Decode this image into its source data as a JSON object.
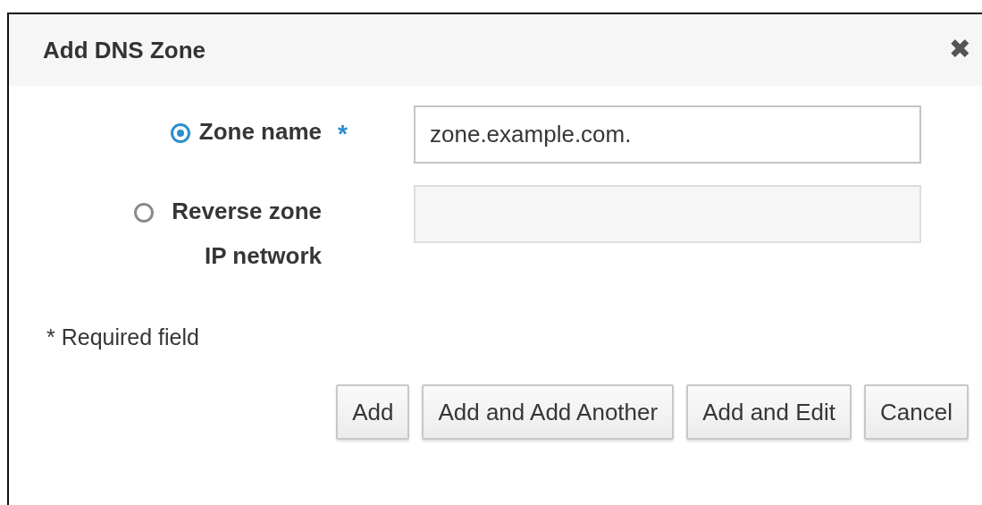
{
  "dialog": {
    "title": "Add DNS Zone",
    "close": "✖"
  },
  "fields": [
    {
      "label": "Zone name",
      "selected": true,
      "required": true,
      "value": "zone.example.com.",
      "disabled": false
    },
    {
      "label": "Reverse zone IP network",
      "selected": false,
      "required": false,
      "disabled": true
    }
  ],
  "required_note": "* Required field",
  "required_mark": "*",
  "buttons": [
    "Add",
    "Add and Add Another",
    "Add and Edit",
    "Cancel"
  ]
}
